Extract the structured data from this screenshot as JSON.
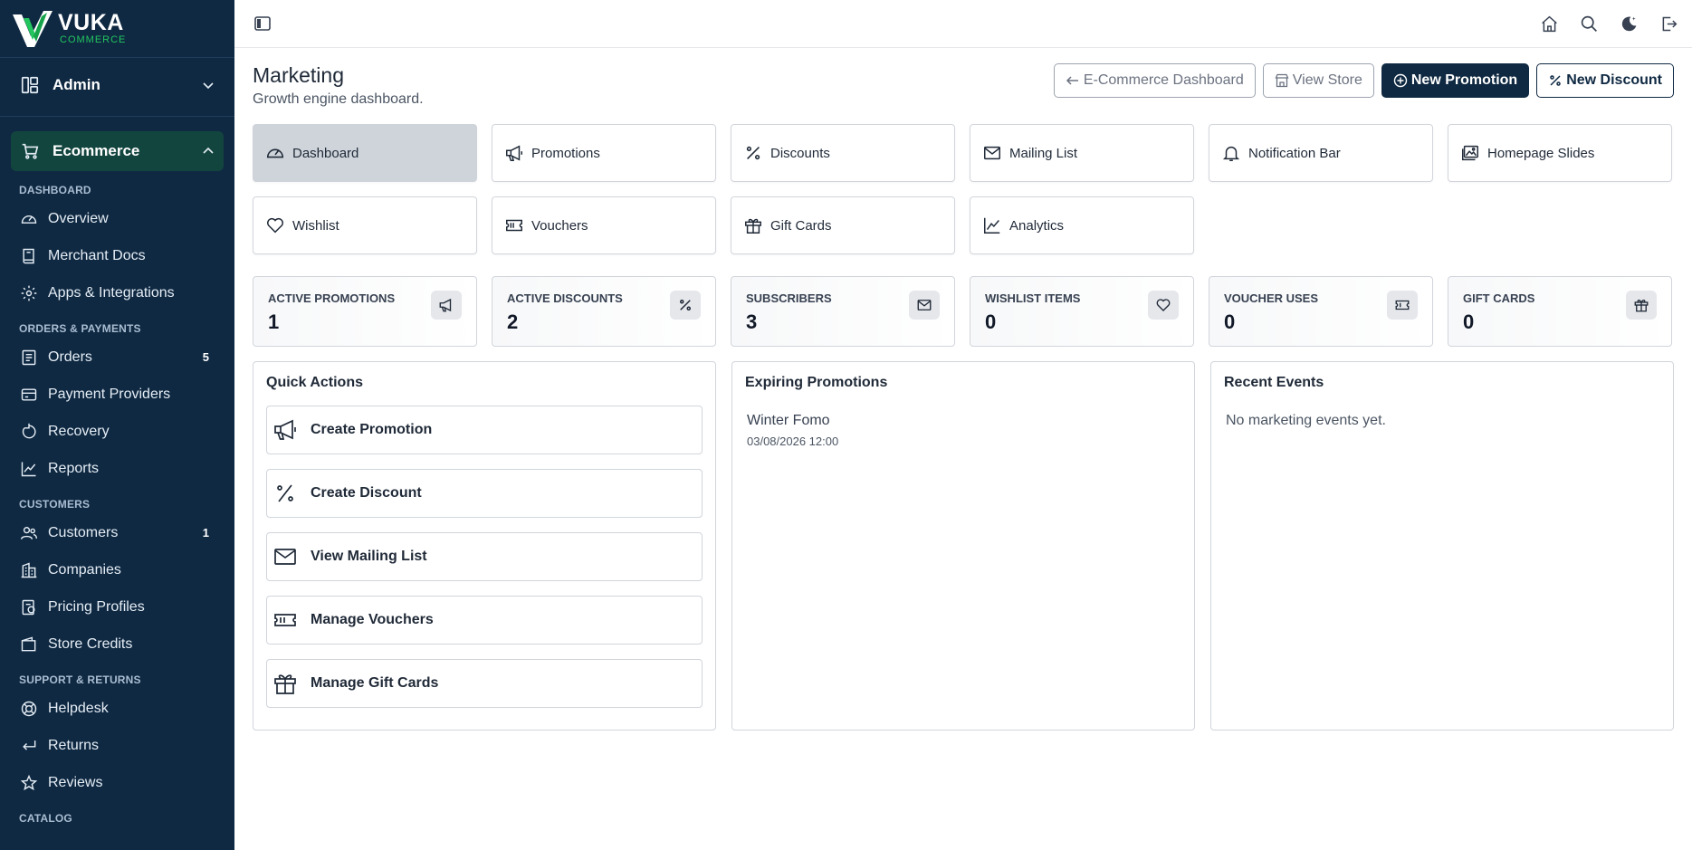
{
  "brand": {
    "name": "VUKA",
    "sub": "COMMERCE"
  },
  "sidebar": {
    "admin": "Admin",
    "ecommerce": "Ecommerce",
    "sections": [
      {
        "label": "Dashboard",
        "items": [
          {
            "label": "Overview",
            "icon": "gauge-icon"
          },
          {
            "label": "Merchant Docs",
            "icon": "book-icon"
          },
          {
            "label": "Apps & Integrations",
            "icon": "gear-icon"
          }
        ]
      },
      {
        "label": "Orders & Payments",
        "items": [
          {
            "label": "Orders",
            "icon": "receipt-icon",
            "count": "5"
          },
          {
            "label": "Payment Providers",
            "icon": "card-icon"
          },
          {
            "label": "Recovery",
            "icon": "refresh-icon"
          },
          {
            "label": "Reports",
            "icon": "chart-icon"
          }
        ]
      },
      {
        "label": "Customers",
        "items": [
          {
            "label": "Customers",
            "icon": "users-icon",
            "count": "1"
          },
          {
            "label": "Companies",
            "icon": "building-icon"
          },
          {
            "label": "Pricing Profiles",
            "icon": "pricing-icon"
          },
          {
            "label": "Store Credits",
            "icon": "wallet-icon"
          }
        ]
      },
      {
        "label": "Support & Returns",
        "items": [
          {
            "label": "Helpdesk",
            "icon": "lifebuoy-icon"
          },
          {
            "label": "Returns",
            "icon": "return-icon"
          },
          {
            "label": "Reviews",
            "icon": "star-icon"
          }
        ]
      },
      {
        "label": "Catalog",
        "items": []
      }
    ]
  },
  "header": {
    "title": "Marketing",
    "subtitle": "Growth engine dashboard.",
    "actions": {
      "ecom_dashboard": "E-Commerce Dashboard",
      "view_store": "View Store",
      "new_promotion": "New Promotion",
      "new_discount": "New Discount"
    }
  },
  "tabs": [
    {
      "label": "Dashboard",
      "icon": "gauge-icon",
      "active": true
    },
    {
      "label": "Promotions",
      "icon": "megaphone-icon"
    },
    {
      "label": "Discounts",
      "icon": "percent-icon"
    },
    {
      "label": "Mailing List",
      "icon": "envelope-icon"
    },
    {
      "label": "Notification Bar",
      "icon": "bell-icon"
    },
    {
      "label": "Homepage Slides",
      "icon": "images-icon"
    },
    {
      "label": "Wishlist",
      "icon": "heart-icon"
    },
    {
      "label": "Vouchers",
      "icon": "ticket-icon"
    },
    {
      "label": "Gift Cards",
      "icon": "gift-icon"
    },
    {
      "label": "Analytics",
      "icon": "line-chart-icon"
    }
  ],
  "stats": [
    {
      "label": "Active Promotions",
      "value": "1",
      "icon": "megaphone-icon"
    },
    {
      "label": "Active Discounts",
      "value": "2",
      "icon": "percent-icon"
    },
    {
      "label": "Subscribers",
      "value": "3",
      "icon": "envelope-icon"
    },
    {
      "label": "Wishlist Items",
      "value": "0",
      "icon": "heart-icon"
    },
    {
      "label": "Voucher Uses",
      "value": "0",
      "icon": "ticket-icon"
    },
    {
      "label": "Gift Cards",
      "value": "0",
      "icon": "gift-icon"
    }
  ],
  "quick_actions": {
    "title": "Quick Actions",
    "items": [
      {
        "label": "Create Promotion",
        "icon": "megaphone-icon"
      },
      {
        "label": "Create Discount",
        "icon": "percent-icon"
      },
      {
        "label": "View Mailing List",
        "icon": "envelope-icon"
      },
      {
        "label": "Manage Vouchers",
        "icon": "ticket-icon"
      },
      {
        "label": "Manage Gift Cards",
        "icon": "gift-icon"
      }
    ]
  },
  "expiring": {
    "title": "Expiring Promotions",
    "items": [
      {
        "name": "Winter Fomo",
        "date": "03/08/2026 12:00"
      }
    ]
  },
  "recent": {
    "title": "Recent Events",
    "empty": "No marketing events yet."
  },
  "colors": {
    "sidebar": "#0f2942",
    "accent_green": "#22c55e",
    "primary_button": "#0f2942"
  }
}
